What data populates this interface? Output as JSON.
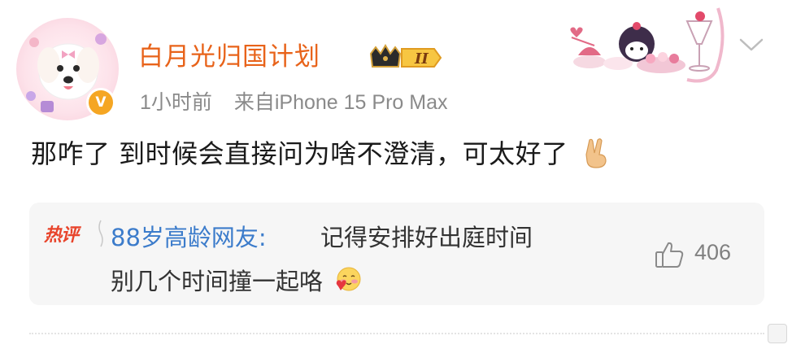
{
  "post": {
    "username": "白月光归国计划",
    "vip_level": "II",
    "verified_mark": "V",
    "time": "1小时前",
    "source": "来自iPhone 15 Pro Max",
    "content": "那咋了 到时候会直接问为啥不澄清，可太好了",
    "content_emoji": "victory-hand",
    "menu_icon": "chevron-down-icon"
  },
  "hot_comment": {
    "tag": "热评",
    "author": "88岁高龄网友:",
    "text_line1": "记得安排好出庭时间",
    "text_line2": "别几个时间撞一起咯",
    "text_emoji": "shy-face-with-heart",
    "likes": "406"
  },
  "colors": {
    "username": "#e8631a",
    "meta": "#8a8a8a",
    "content": "#1a1a1a",
    "hot_tag": "#e8442b",
    "comment_author": "#3c7ccb",
    "comment_bg": "#f6f6f6",
    "verify_badge": "#f5a623"
  }
}
